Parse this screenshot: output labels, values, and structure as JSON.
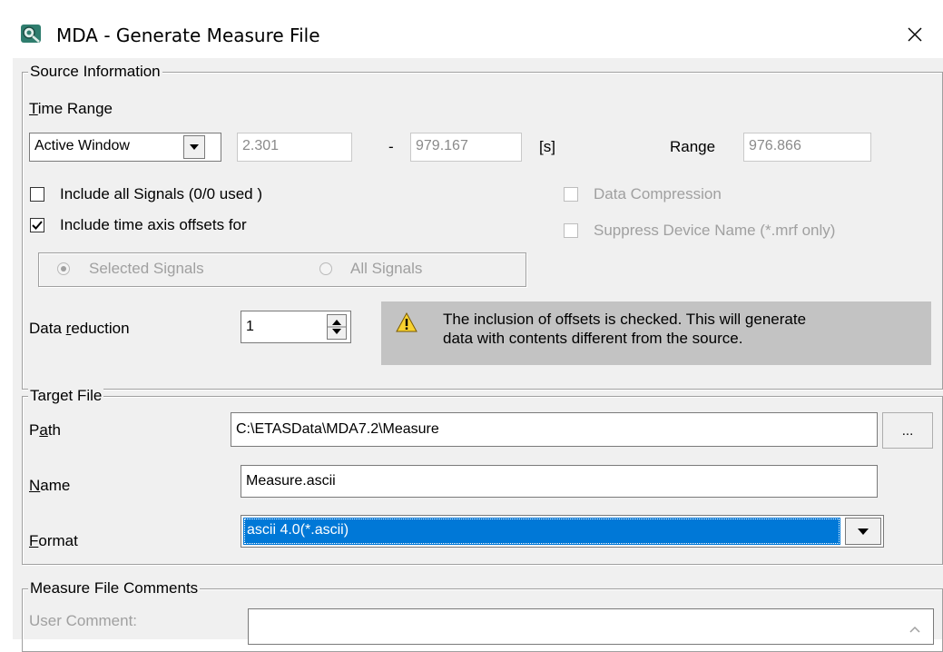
{
  "window": {
    "title": "MDA - Generate Measure File",
    "close_glyph": "✕"
  },
  "source_info": {
    "legend": "Source Information",
    "time_range_label": "Time Range",
    "time_range_mode": "Active Window",
    "start": "2.301",
    "separator": "-",
    "end": "979.167",
    "unit": "[s]",
    "range_label": "Range",
    "range_value": "976.866",
    "include_all_signals": {
      "label": "Include all Signals (0/0 used )",
      "checked": false
    },
    "include_offsets": {
      "label": "Include time axis offsets for",
      "checked": true
    },
    "data_compression": {
      "label": "Data Compression",
      "checked": false,
      "enabled": false
    },
    "suppress_device": {
      "label": "Suppress Device Name (*.mrf only)",
      "checked": false,
      "enabled": false
    },
    "offset_target": {
      "selected_signals": "Selected Signals",
      "all_signals": "All Signals",
      "selected": "selected_signals"
    },
    "data_reduction_label": "Data reduction",
    "data_reduction_value": "1",
    "warning_line1": "The inclusion of offsets is checked. This will generate",
    "warning_line2": "data with contents different from the source."
  },
  "target_file": {
    "legend": "Target File",
    "path_label": "Path",
    "path_value": "C:\\ETASData\\MDA7.2\\Measure",
    "browse_label": "...",
    "name_label": "Name",
    "name_value": "Measure.ascii",
    "format_label": "Format",
    "format_value": "ascii 4.0(*.ascii)"
  },
  "comments": {
    "legend": "Measure File Comments",
    "user_comment_label": "User Comment:",
    "user_comment_value": ""
  },
  "colors": {
    "dialog_bg": "#f0f0f0",
    "selection": "#0078d7",
    "warning_bg": "#c3c3c3"
  }
}
